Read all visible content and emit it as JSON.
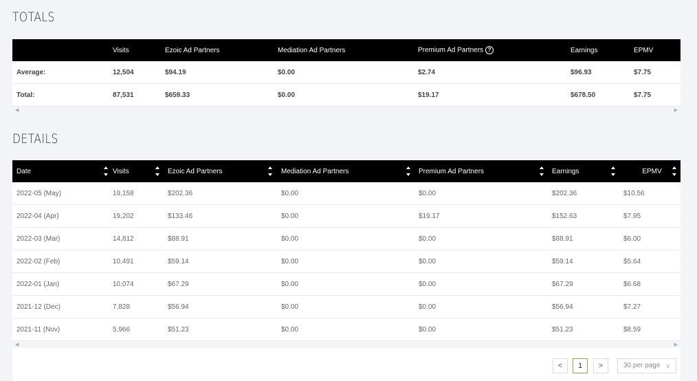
{
  "totals": {
    "title": "TOTALS",
    "headers": [
      "",
      "Visits",
      "Ezoic Ad Partners",
      "Mediation Ad Partners",
      "Premium Ad Partners",
      "Earnings",
      "EPMV"
    ],
    "rows": [
      [
        "Average:",
        "12,504",
        "$94.19",
        "$0.00",
        "$2.74",
        "$96.93",
        "$7.75"
      ],
      [
        "Total:",
        "87,531",
        "$659.33",
        "$0.00",
        "$19.17",
        "$678.50",
        "$7.75"
      ]
    ]
  },
  "details": {
    "title": "DETAILS",
    "headers": [
      "Date",
      "Visits",
      "Ezoic Ad Partners",
      "Mediation Ad Partners",
      "Premium Ad Partners",
      "Earnings",
      "EPMV"
    ],
    "rows": [
      [
        "2022-05 (May)",
        "19,158",
        "$202.36",
        "$0.00",
        "$0.00",
        "$202.36",
        "$10.56"
      ],
      [
        "2022-04 (Apr)",
        "19,202",
        "$133.46",
        "$0.00",
        "$19.17",
        "$152.63",
        "$7.95"
      ],
      [
        "2022-03 (Mar)",
        "14,812",
        "$88.91",
        "$0.00",
        "$0.00",
        "$88.91",
        "$6.00"
      ],
      [
        "2022-02 (Feb)",
        "10,491",
        "$59.14",
        "$0.00",
        "$0.00",
        "$59.14",
        "$5.64"
      ],
      [
        "2022-01 (Jan)",
        "10,074",
        "$67.29",
        "$0.00",
        "$0.00",
        "$67.29",
        "$6.68"
      ],
      [
        "2021-12 (Dec)",
        "7,828",
        "$56.94",
        "$0.00",
        "$0.00",
        "$56.94",
        "$7.27"
      ],
      [
        "2021-11 (Nov)",
        "5,966",
        "$51.23",
        "$0.00",
        "$0.00",
        "$51.23",
        "$8.59"
      ]
    ]
  },
  "pagination": {
    "prev": "<",
    "current_page": "1",
    "next": ">",
    "per_page": "30 per page"
  },
  "icons": {
    "help": "?",
    "scroll_left": "◀",
    "scroll_right": "▶",
    "dropdown": "∨"
  }
}
